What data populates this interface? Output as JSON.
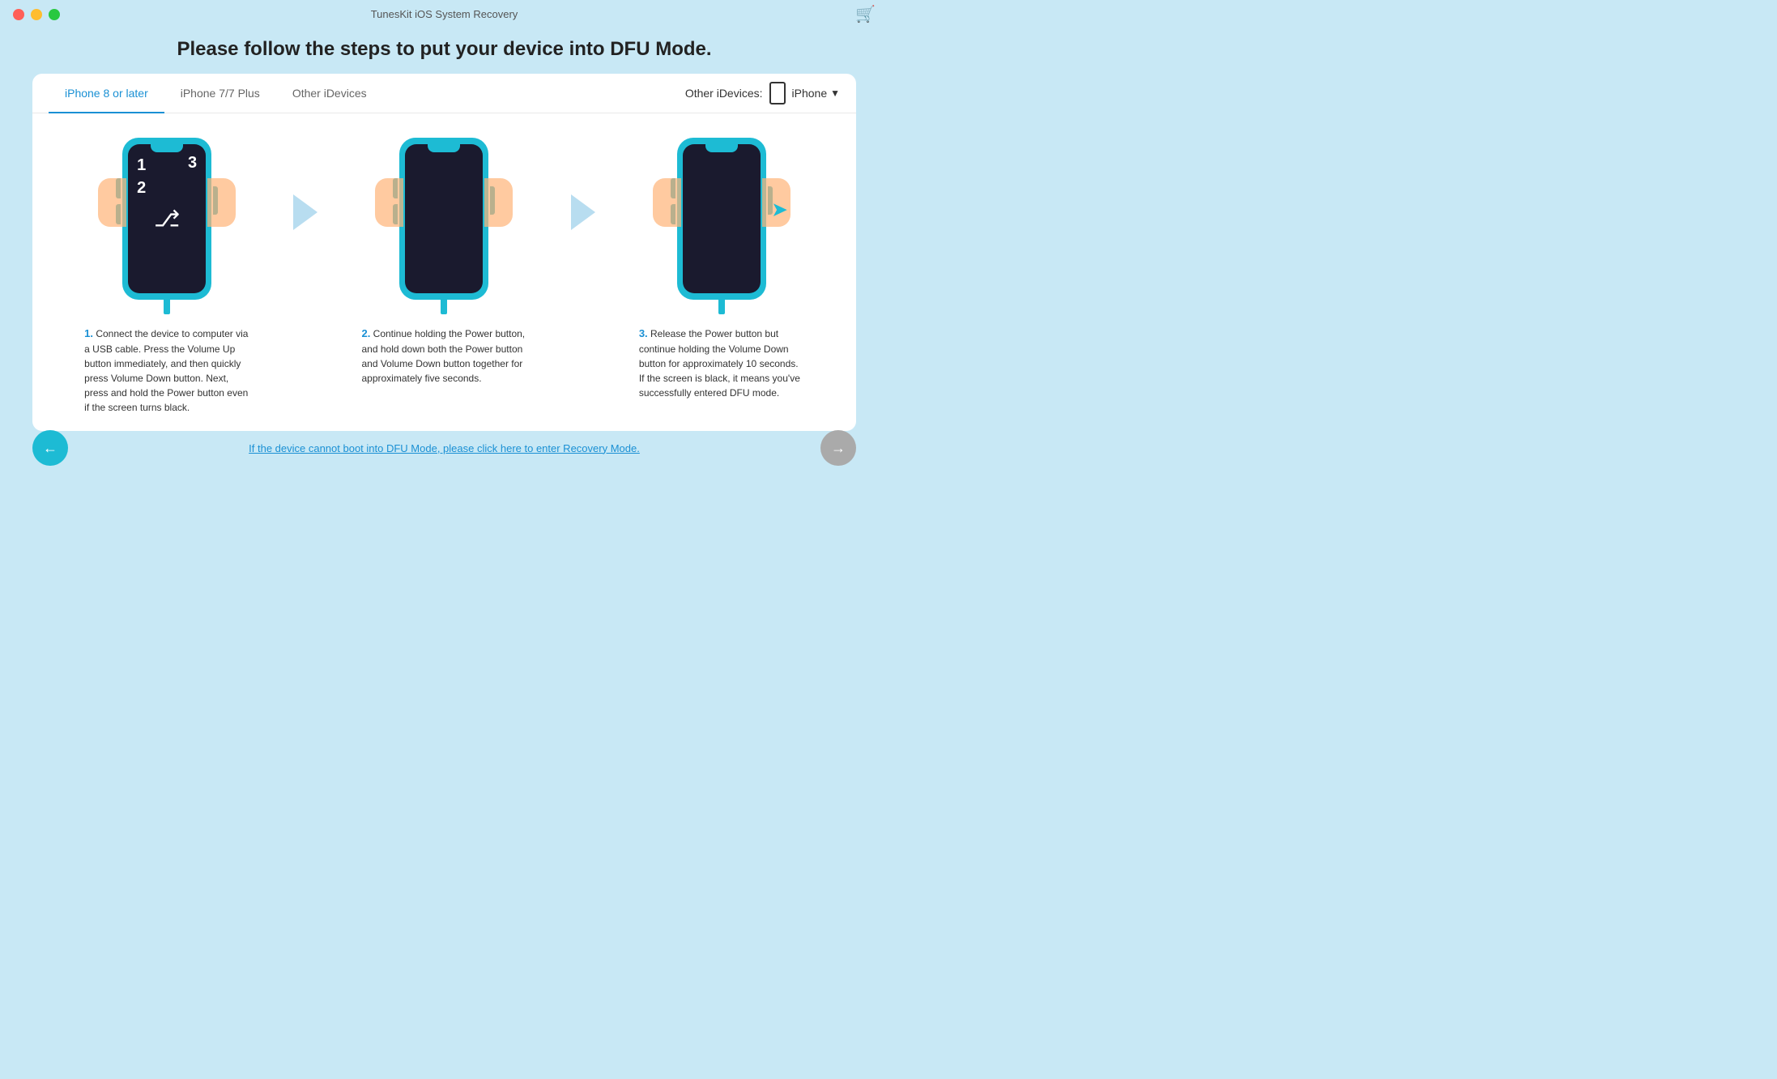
{
  "window": {
    "title": "TunesKit iOS System Recovery"
  },
  "heading": "Please follow the steps to put your device into DFU Mode.",
  "tabs": [
    {
      "id": "iphone8",
      "label": "iPhone 8 or later",
      "active": true
    },
    {
      "id": "iphone7",
      "label": "iPhone 7/7 Plus",
      "active": false
    },
    {
      "id": "other",
      "label": "Other iDevices",
      "active": false
    }
  ],
  "other_devices_label": "Other iDevices:",
  "device_selector": "iPhone",
  "steps": [
    {
      "number": "1",
      "extra_number": "2",
      "desc_number": "1.",
      "description": "Connect the device to computer via a USB cable. Press the Volume Up button immediately, and then quickly press Volume Down button. Next, press and hold the Power button even if the screen turns black."
    },
    {
      "number": "",
      "desc_number": "2.",
      "description": "Continue holding the Power button, and hold down both the Power button and Volume Down button together for approximately five seconds."
    },
    {
      "number": "3",
      "desc_number": "3.",
      "description": "Release the Power button but continue holding the Volume Down button for approximately 10 seconds. If the screen is black, it means you've successfully entered DFU mode."
    }
  ],
  "recovery_link": "If the device cannot boot into DFU Mode, please click here to enter Recovery Mode.",
  "nav": {
    "back": "←",
    "next": "→"
  }
}
